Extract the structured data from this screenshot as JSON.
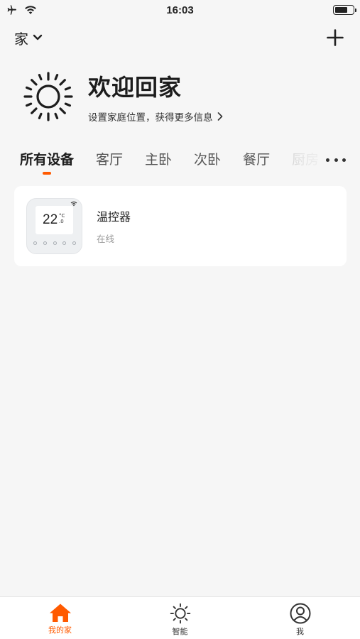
{
  "status_bar": {
    "time": "16:03",
    "battery_level": 0.7,
    "icons": [
      "airplane-icon",
      "wifi-icon",
      "battery-icon"
    ]
  },
  "header": {
    "home_name": "家",
    "icons": [
      "chevron-down-icon",
      "plus-icon"
    ]
  },
  "welcome": {
    "title": "欢迎回家",
    "subtitle": "设置家庭位置，获得更多信息",
    "icon": "sun-icon"
  },
  "tabs": [
    {
      "label": "所有设备",
      "active": true
    },
    {
      "label": "客厅",
      "active": false
    },
    {
      "label": "主卧",
      "active": false
    },
    {
      "label": "次卧",
      "active": false
    },
    {
      "label": "餐厅",
      "active": false
    },
    {
      "label": "厨房",
      "active": false
    }
  ],
  "devices": [
    {
      "name": "温控器",
      "status": "在线",
      "thumbnail": {
        "temperature": "22",
        "unit_top": "°C",
        "unit_bottom": ".0"
      }
    }
  ],
  "bottom_nav": [
    {
      "label": "我的家",
      "icon": "home-icon",
      "active": true
    },
    {
      "label": "智能",
      "icon": "sun-icon",
      "active": false
    },
    {
      "label": "我",
      "icon": "user-icon",
      "active": false
    }
  ],
  "colors": {
    "accent": "#ff5a00",
    "background": "#f6f6f6",
    "card": "#ffffff"
  }
}
